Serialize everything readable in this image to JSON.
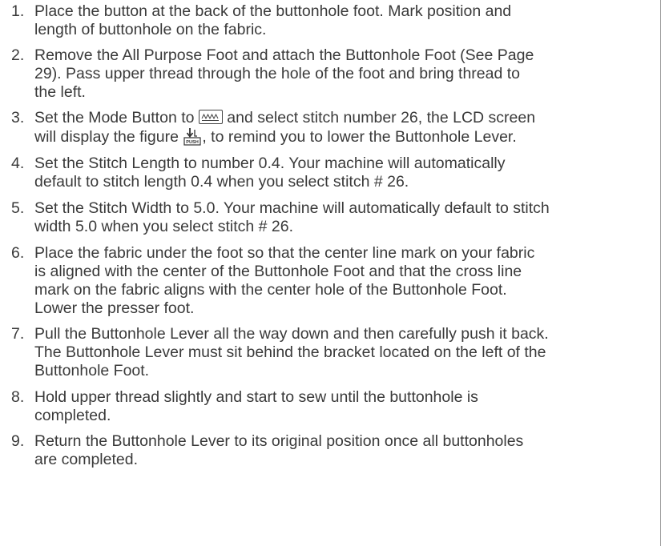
{
  "steps": [
    {
      "number": "1.",
      "lines": [
        "Place the button at the back of the buttonhole foot. Mark position and",
        "length of buttonhole on the fabric."
      ]
    },
    {
      "number": "2.",
      "lines": [
        "Remove the All Purpose Foot and attach the Buttonhole Foot (See Page",
        "29).  Pass upper thread through the hole of the foot and bring thread to",
        "the left."
      ]
    },
    {
      "number": "3.",
      "line1_before_icon": "Set the Mode Button to ",
      "line1_after_icon": " and select stitch number 26, the LCD screen",
      "line2_before_icon": "will display the figure ",
      "line2_after_icon": ", to remind you to lower the Buttonhole Lever.",
      "mode_icon": "zigzag-mode-icon",
      "push_icon": "push-lever-icon",
      "push_label": "PUSH"
    },
    {
      "number": "4.",
      "lines": [
        "Set the Stitch Length to number 0.4. Your machine will automatically",
        "default to stitch length 0.4 when you select stitch # 26."
      ]
    },
    {
      "number": "5.",
      "lines": [
        "Set the Stitch Width to 5.0. Your machine will automatically default to stitch",
        "width 5.0 when you select stitch # 26."
      ]
    },
    {
      "number": "6.",
      "lines": [
        "Place the fabric under the foot so that the center line mark on your fabric",
        "is aligned with the center of the Buttonhole Foot and that the cross line",
        "mark on the fabric aligns with the center hole of the Buttonhole Foot.",
        "Lower the presser foot."
      ]
    },
    {
      "number": "7.",
      "lines": [
        "Pull the Buttonhole Lever all the way down and then carefully push it back.",
        "The Buttonhole Lever must sit behind the bracket located on the left of the",
        "Buttonhole Foot."
      ]
    },
    {
      "number": "8.",
      "lines": [
        "Hold upper thread slightly and start to sew until the buttonhole is",
        "completed."
      ]
    },
    {
      "number": "9.",
      "lines": [
        "Return the Buttonhole Lever to its original position once all buttonholes",
        "are completed."
      ]
    }
  ]
}
